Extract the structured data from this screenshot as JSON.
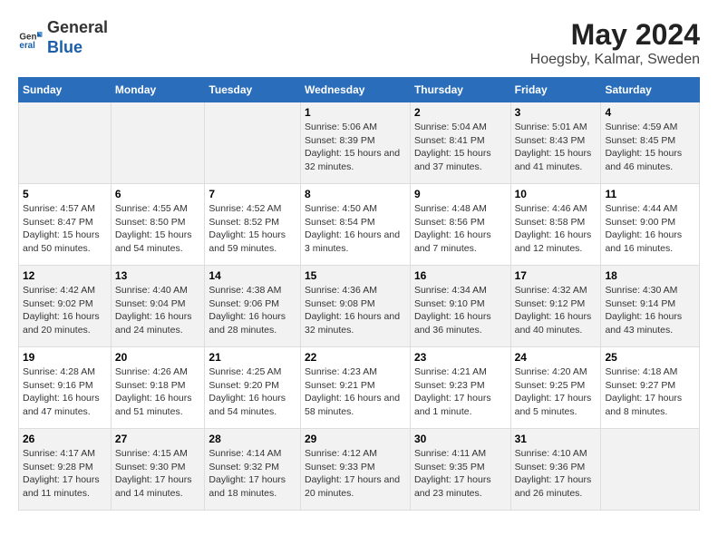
{
  "header": {
    "logo_general": "General",
    "logo_blue": "Blue",
    "main_title": "May 2024",
    "subtitle": "Hoegsby, Kalmar, Sweden"
  },
  "days_of_week": [
    "Sunday",
    "Monday",
    "Tuesday",
    "Wednesday",
    "Thursday",
    "Friday",
    "Saturday"
  ],
  "weeks": [
    [
      {
        "day": "",
        "info": ""
      },
      {
        "day": "",
        "info": ""
      },
      {
        "day": "",
        "info": ""
      },
      {
        "day": "1",
        "info": "Sunrise: 5:06 AM\nSunset: 8:39 PM\nDaylight: 15 hours\nand 32 minutes."
      },
      {
        "day": "2",
        "info": "Sunrise: 5:04 AM\nSunset: 8:41 PM\nDaylight: 15 hours\nand 37 minutes."
      },
      {
        "day": "3",
        "info": "Sunrise: 5:01 AM\nSunset: 8:43 PM\nDaylight: 15 hours\nand 41 minutes."
      },
      {
        "day": "4",
        "info": "Sunrise: 4:59 AM\nSunset: 8:45 PM\nDaylight: 15 hours\nand 46 minutes."
      }
    ],
    [
      {
        "day": "5",
        "info": "Sunrise: 4:57 AM\nSunset: 8:47 PM\nDaylight: 15 hours\nand 50 minutes."
      },
      {
        "day": "6",
        "info": "Sunrise: 4:55 AM\nSunset: 8:50 PM\nDaylight: 15 hours\nand 54 minutes."
      },
      {
        "day": "7",
        "info": "Sunrise: 4:52 AM\nSunset: 8:52 PM\nDaylight: 15 hours\nand 59 minutes."
      },
      {
        "day": "8",
        "info": "Sunrise: 4:50 AM\nSunset: 8:54 PM\nDaylight: 16 hours\nand 3 minutes."
      },
      {
        "day": "9",
        "info": "Sunrise: 4:48 AM\nSunset: 8:56 PM\nDaylight: 16 hours\nand 7 minutes."
      },
      {
        "day": "10",
        "info": "Sunrise: 4:46 AM\nSunset: 8:58 PM\nDaylight: 16 hours\nand 12 minutes."
      },
      {
        "day": "11",
        "info": "Sunrise: 4:44 AM\nSunset: 9:00 PM\nDaylight: 16 hours\nand 16 minutes."
      }
    ],
    [
      {
        "day": "12",
        "info": "Sunrise: 4:42 AM\nSunset: 9:02 PM\nDaylight: 16 hours\nand 20 minutes."
      },
      {
        "day": "13",
        "info": "Sunrise: 4:40 AM\nSunset: 9:04 PM\nDaylight: 16 hours\nand 24 minutes."
      },
      {
        "day": "14",
        "info": "Sunrise: 4:38 AM\nSunset: 9:06 PM\nDaylight: 16 hours\nand 28 minutes."
      },
      {
        "day": "15",
        "info": "Sunrise: 4:36 AM\nSunset: 9:08 PM\nDaylight: 16 hours\nand 32 minutes."
      },
      {
        "day": "16",
        "info": "Sunrise: 4:34 AM\nSunset: 9:10 PM\nDaylight: 16 hours\nand 36 minutes."
      },
      {
        "day": "17",
        "info": "Sunrise: 4:32 AM\nSunset: 9:12 PM\nDaylight: 16 hours\nand 40 minutes."
      },
      {
        "day": "18",
        "info": "Sunrise: 4:30 AM\nSunset: 9:14 PM\nDaylight: 16 hours\nand 43 minutes."
      }
    ],
    [
      {
        "day": "19",
        "info": "Sunrise: 4:28 AM\nSunset: 9:16 PM\nDaylight: 16 hours\nand 47 minutes."
      },
      {
        "day": "20",
        "info": "Sunrise: 4:26 AM\nSunset: 9:18 PM\nDaylight: 16 hours\nand 51 minutes."
      },
      {
        "day": "21",
        "info": "Sunrise: 4:25 AM\nSunset: 9:20 PM\nDaylight: 16 hours\nand 54 minutes."
      },
      {
        "day": "22",
        "info": "Sunrise: 4:23 AM\nSunset: 9:21 PM\nDaylight: 16 hours\nand 58 minutes."
      },
      {
        "day": "23",
        "info": "Sunrise: 4:21 AM\nSunset: 9:23 PM\nDaylight: 17 hours\nand 1 minute."
      },
      {
        "day": "24",
        "info": "Sunrise: 4:20 AM\nSunset: 9:25 PM\nDaylight: 17 hours\nand 5 minutes."
      },
      {
        "day": "25",
        "info": "Sunrise: 4:18 AM\nSunset: 9:27 PM\nDaylight: 17 hours\nand 8 minutes."
      }
    ],
    [
      {
        "day": "26",
        "info": "Sunrise: 4:17 AM\nSunset: 9:28 PM\nDaylight: 17 hours\nand 11 minutes."
      },
      {
        "day": "27",
        "info": "Sunrise: 4:15 AM\nSunset: 9:30 PM\nDaylight: 17 hours\nand 14 minutes."
      },
      {
        "day": "28",
        "info": "Sunrise: 4:14 AM\nSunset: 9:32 PM\nDaylight: 17 hours\nand 18 minutes."
      },
      {
        "day": "29",
        "info": "Sunrise: 4:12 AM\nSunset: 9:33 PM\nDaylight: 17 hours\nand 20 minutes."
      },
      {
        "day": "30",
        "info": "Sunrise: 4:11 AM\nSunset: 9:35 PM\nDaylight: 17 hours\nand 23 minutes."
      },
      {
        "day": "31",
        "info": "Sunrise: 4:10 AM\nSunset: 9:36 PM\nDaylight: 17 hours\nand 26 minutes."
      },
      {
        "day": "",
        "info": ""
      }
    ]
  ]
}
